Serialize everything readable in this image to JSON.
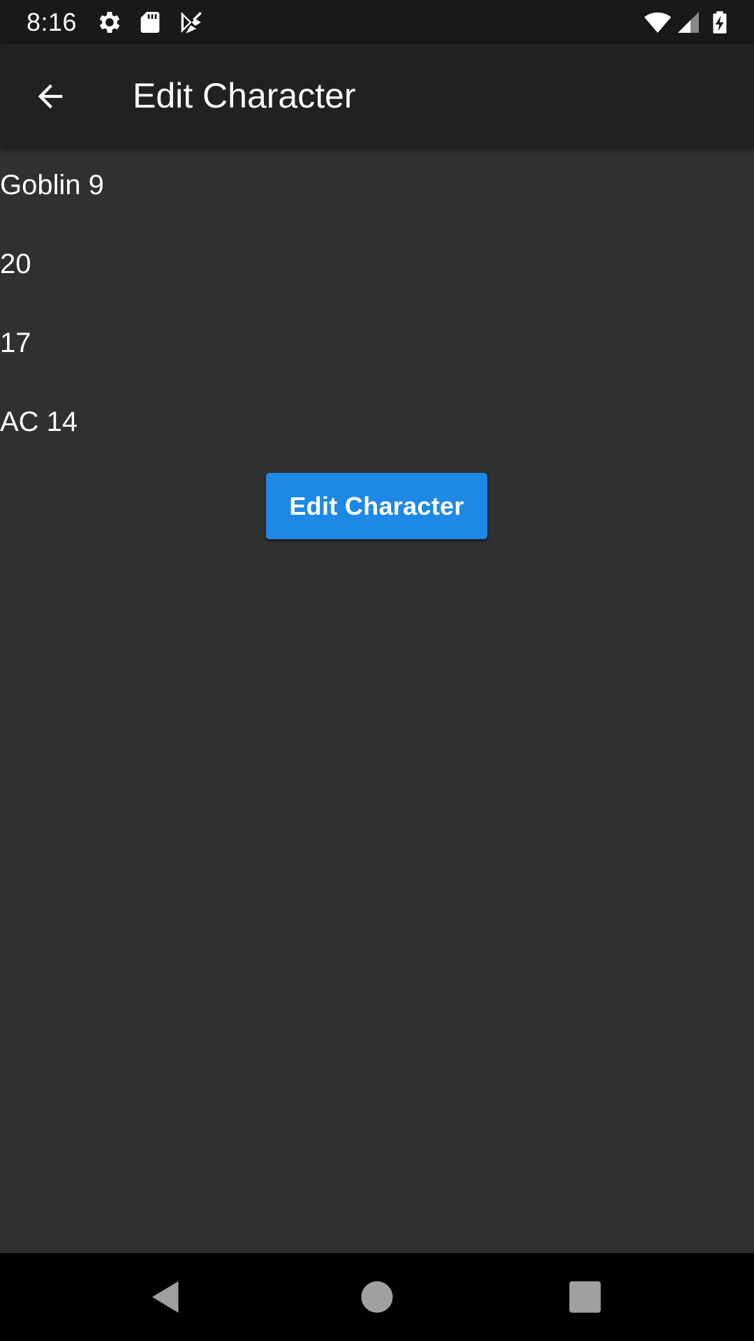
{
  "status_bar": {
    "time": "8:16",
    "icons": [
      "gear-icon",
      "sd-card-icon",
      "play-store-icon",
      "wifi-icon",
      "cell-signal-icon",
      "battery-charging-icon"
    ]
  },
  "app_bar": {
    "title": "Edit Character",
    "back_icon": "arrow-back-icon"
  },
  "character": {
    "name": "Goblin 9",
    "stat_1": "20",
    "stat_2": "17",
    "armor_class": "AC 14"
  },
  "actions": {
    "edit_label": "Edit Character"
  },
  "nav_bar": {
    "icons": [
      "back-triangle-icon",
      "home-circle-icon",
      "recents-square-icon"
    ]
  },
  "colors": {
    "background": "#303030",
    "app_bar": "#212121",
    "status_bar": "#191919",
    "accent": "#1e88e5",
    "nav_bar": "#000000"
  }
}
